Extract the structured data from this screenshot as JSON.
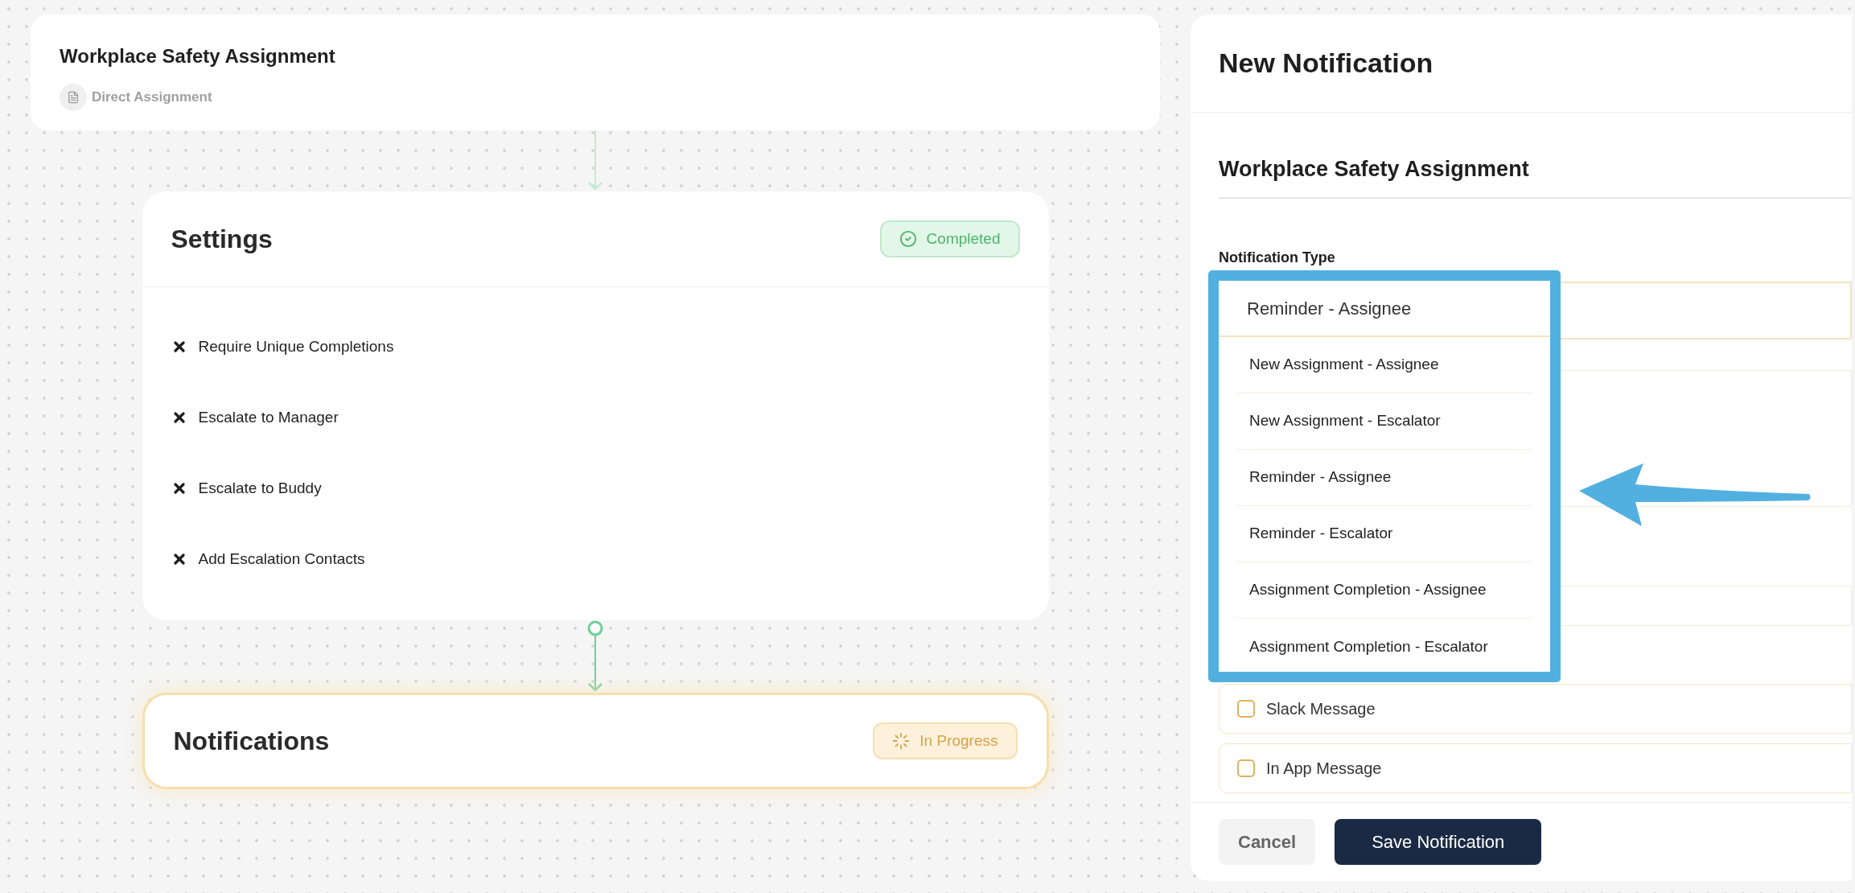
{
  "top_card": {
    "title": "Workplace Safety Assignment",
    "subtitle": "Direct Assignment"
  },
  "steps": [
    {
      "title": "Settings",
      "kind": "completed",
      "status_label": "Completed",
      "items": [
        {
          "label": "Require Unique Completions",
          "enabled": false
        },
        {
          "label": "Escalate to Manager",
          "enabled": false
        },
        {
          "label": "Escalate to Buddy",
          "enabled": false
        },
        {
          "label": "Add Escalation Contacts",
          "enabled": false
        }
      ]
    },
    {
      "title": "Notifications",
      "kind": "in_progress",
      "status_label": "In Progress"
    }
  ],
  "panel": {
    "title": "New Notification",
    "section_title": "Workplace Safety Assignment",
    "type_label": "Notification Type",
    "type_value": "Reminder - Assignee",
    "type_options": [
      "New Assignment - Assignee",
      "New Assignment - Escalator",
      "Reminder - Assignee",
      "Reminder - Escalator",
      "Assignment Completion - Assignee",
      "Assignment Completion - Escalator"
    ],
    "channels": [
      {
        "label": "Slack Message",
        "checked": false
      },
      {
        "label": "In App Message",
        "checked": false
      }
    ],
    "buttons": [
      {
        "label": "Cancel",
        "kind": "secondary"
      },
      {
        "label": "Save Notification",
        "kind": "primary"
      }
    ]
  }
}
